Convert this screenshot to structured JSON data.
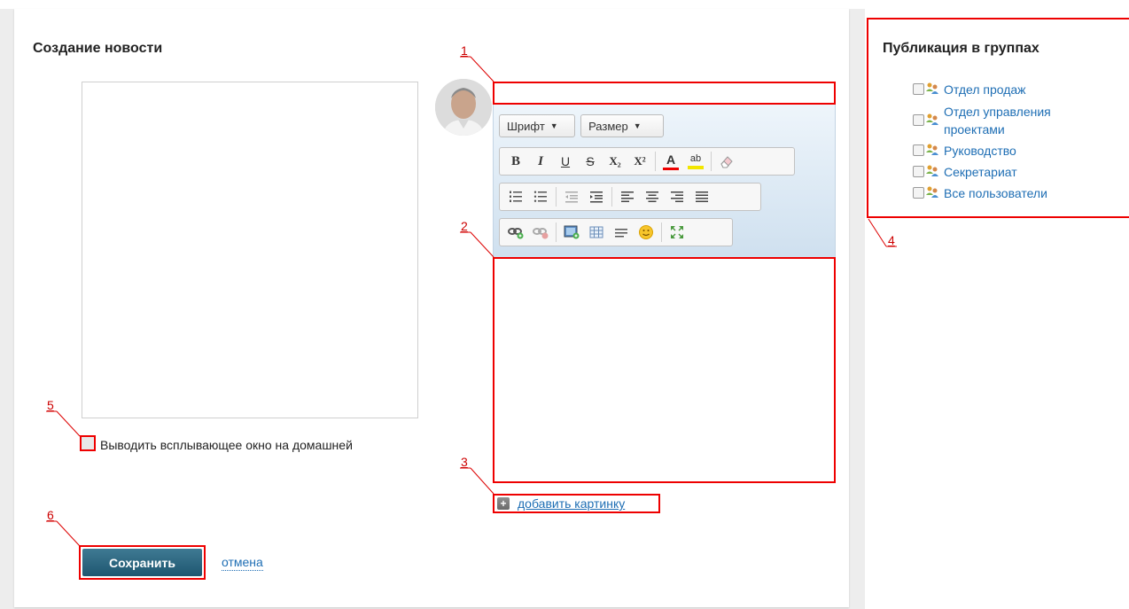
{
  "page": {
    "title": "Создание новости",
    "popup_checkbox_label": "Выводить всплывающее окно на домашней",
    "save_label": "Сохранить",
    "cancel_label": "отмена",
    "add_image_label": "добавить картинку",
    "add_image_plus": "+"
  },
  "editor": {
    "font_label": "Шрифт",
    "size_label": "Размер",
    "format_buttons": [
      "B",
      "I",
      "U",
      "S",
      "X₂",
      "X²",
      "A",
      "ab"
    ]
  },
  "groups": {
    "title": "Публикация в группах",
    "items": [
      {
        "label": "Отдел продаж"
      },
      {
        "label": "Отдел управления проектами"
      },
      {
        "label": "Руководство"
      },
      {
        "label": "Секретариат"
      },
      {
        "label": "Все пользователи"
      }
    ]
  },
  "callouts": [
    "1",
    "2",
    "3",
    "4",
    "5",
    "6"
  ],
  "colors": {
    "accent_red": "#e00000",
    "link_blue": "#1e6eb4",
    "button_teal": "#2a6580"
  }
}
